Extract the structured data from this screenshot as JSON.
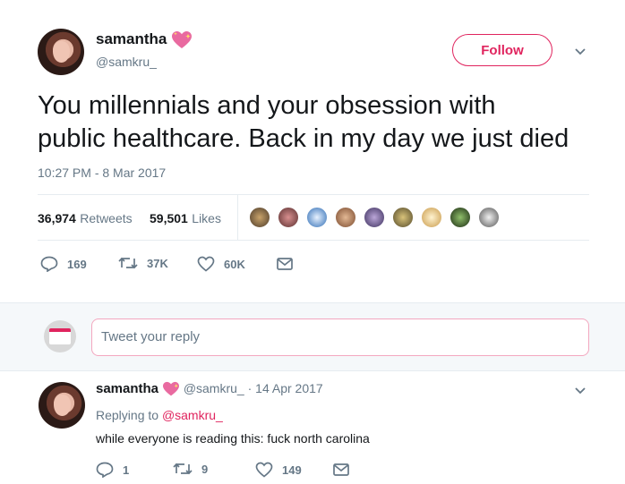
{
  "tweet": {
    "display_name": "samantha",
    "handle": "@samkru_",
    "follow_label": "Follow",
    "text_line1": "You millennials and your obsession with",
    "text_line2": "public healthcare. Back in my day we just died",
    "timestamp": "10:27 PM - 8 Mar 2017",
    "retweets_count": "36,974",
    "retweets_label": "Retweets",
    "likes_count": "59,501",
    "likes_label": "Likes",
    "actions": {
      "replies": "169",
      "retweets": "37K",
      "likes": "60K"
    }
  },
  "reply_box": {
    "placeholder": "Tweet your reply"
  },
  "reply": {
    "display_name": "samantha",
    "handle": "@samkru_",
    "separator": "·",
    "date": "14 Apr 2017",
    "replying_prefix": "Replying to",
    "replying_to": "@samkru_",
    "text": "while everyone is reading this: fuck north carolina",
    "actions": {
      "replies": "1",
      "retweets": "9",
      "likes": "149"
    }
  },
  "colors": {
    "accent": "#e0245e",
    "muted": "#657786",
    "text": "#14171a",
    "divider": "#e6ecf0"
  },
  "icons": [
    "heart-emoji-icon",
    "chevron-down-icon",
    "reply-icon",
    "retweet-icon",
    "like-icon",
    "message-icon"
  ]
}
